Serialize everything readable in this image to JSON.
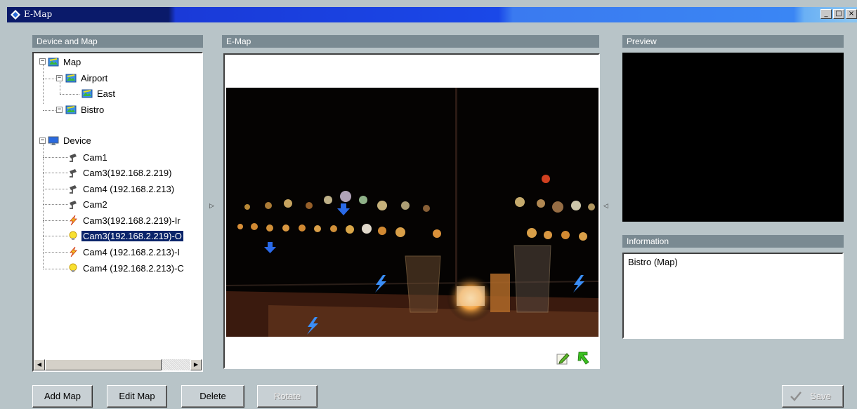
{
  "window": {
    "title": "E-Map",
    "minimize": "_",
    "maximize": "□",
    "close": "×"
  },
  "panels": {
    "device_map_title": "Device and Map",
    "emap_title": "E-Map",
    "preview_title": "Preview",
    "information_title": "Information"
  },
  "tree": {
    "map": "Map",
    "airport": "Airport",
    "east": "East",
    "bistro": "Bistro",
    "device": "Device",
    "cam1": "Cam1",
    "cam3": "Cam3(192.168.2.219)",
    "cam4": "Cam4 (192.168.2.213)",
    "cam2": "Cam2",
    "cam3_in": "Cam3(192.168.2.219)-Ir",
    "cam3_out": "Cam3(192.168.2.219)-O",
    "cam4_in": "Cam4 (192.168.2.213)-I",
    "cam4_out": "Cam4 (192.168.2.213)-C",
    "selected": "cam3_out"
  },
  "information": {
    "text": "Bistro (Map)"
  },
  "buttons": {
    "add_map": "Add Map",
    "edit_map": "Edit Map",
    "delete": "Delete",
    "rotate": "Rotate",
    "save": "Save",
    "rotate_enabled": false,
    "save_enabled": false
  },
  "map_markers": {
    "cameras": 2,
    "sensors": 3
  },
  "colors": {
    "background": "#b8c4c8",
    "panel_header": "#7a8a92",
    "selection": "#0a246a",
    "title_dark": "#0a1a6a",
    "title_light": "#3a86f4"
  }
}
